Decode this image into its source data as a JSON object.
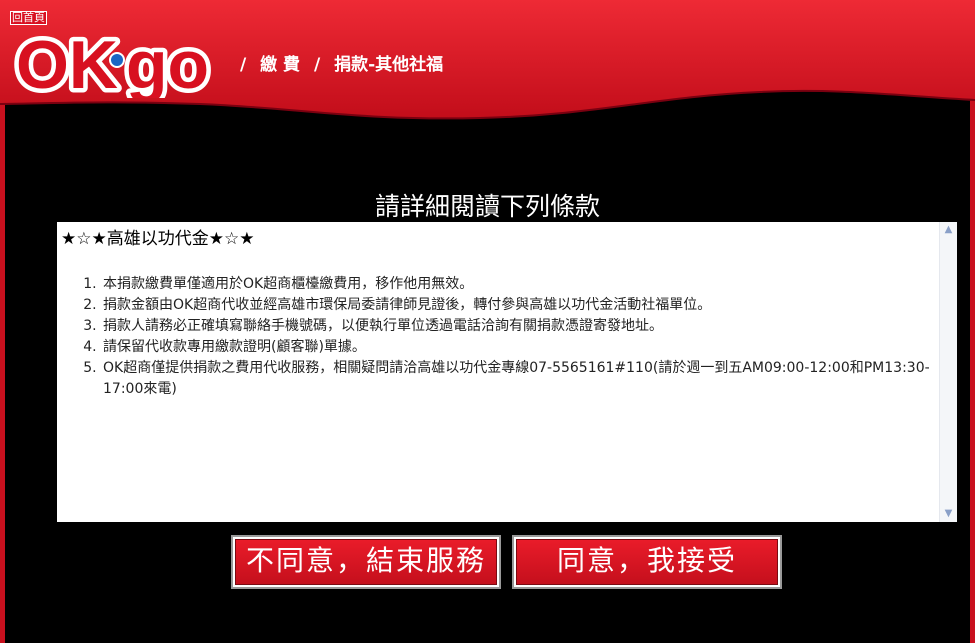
{
  "header": {
    "home_link": "回首頁",
    "logo_text": "OK·go",
    "breadcrumb": [
      "/",
      "繳 費",
      "/",
      "捐款-其他社福"
    ]
  },
  "page_title": "請詳細閱讀下列條款",
  "terms": {
    "title": "★☆★高雄以功代金★☆★",
    "items": [
      "本捐款繳費單僅適用於OK超商櫃檯繳費用，移作他用無效。",
      "捐款金額由OK超商代收並經高雄市環保局委請律師見證後，轉付參與高雄以功代金活動社福單位。",
      "捐款人請務必正確填寫聯絡手機號碼，以便執行單位透過電話洽詢有關捐款憑證寄發地址。",
      "請保留代收款專用繳款證明(顧客聯)單據。",
      "OK超商僅提供捐款之費用代收服務，相關疑問請洽高雄以功代金專線07-5565161#110(請於週一到五AM09:00-12:00和PM13:30-17:00來電)"
    ]
  },
  "buttons": {
    "decline": "不同意，結束服務",
    "accept": "同意，我接受"
  },
  "colors": {
    "brand_red": "#d81020",
    "background": "#000000"
  }
}
